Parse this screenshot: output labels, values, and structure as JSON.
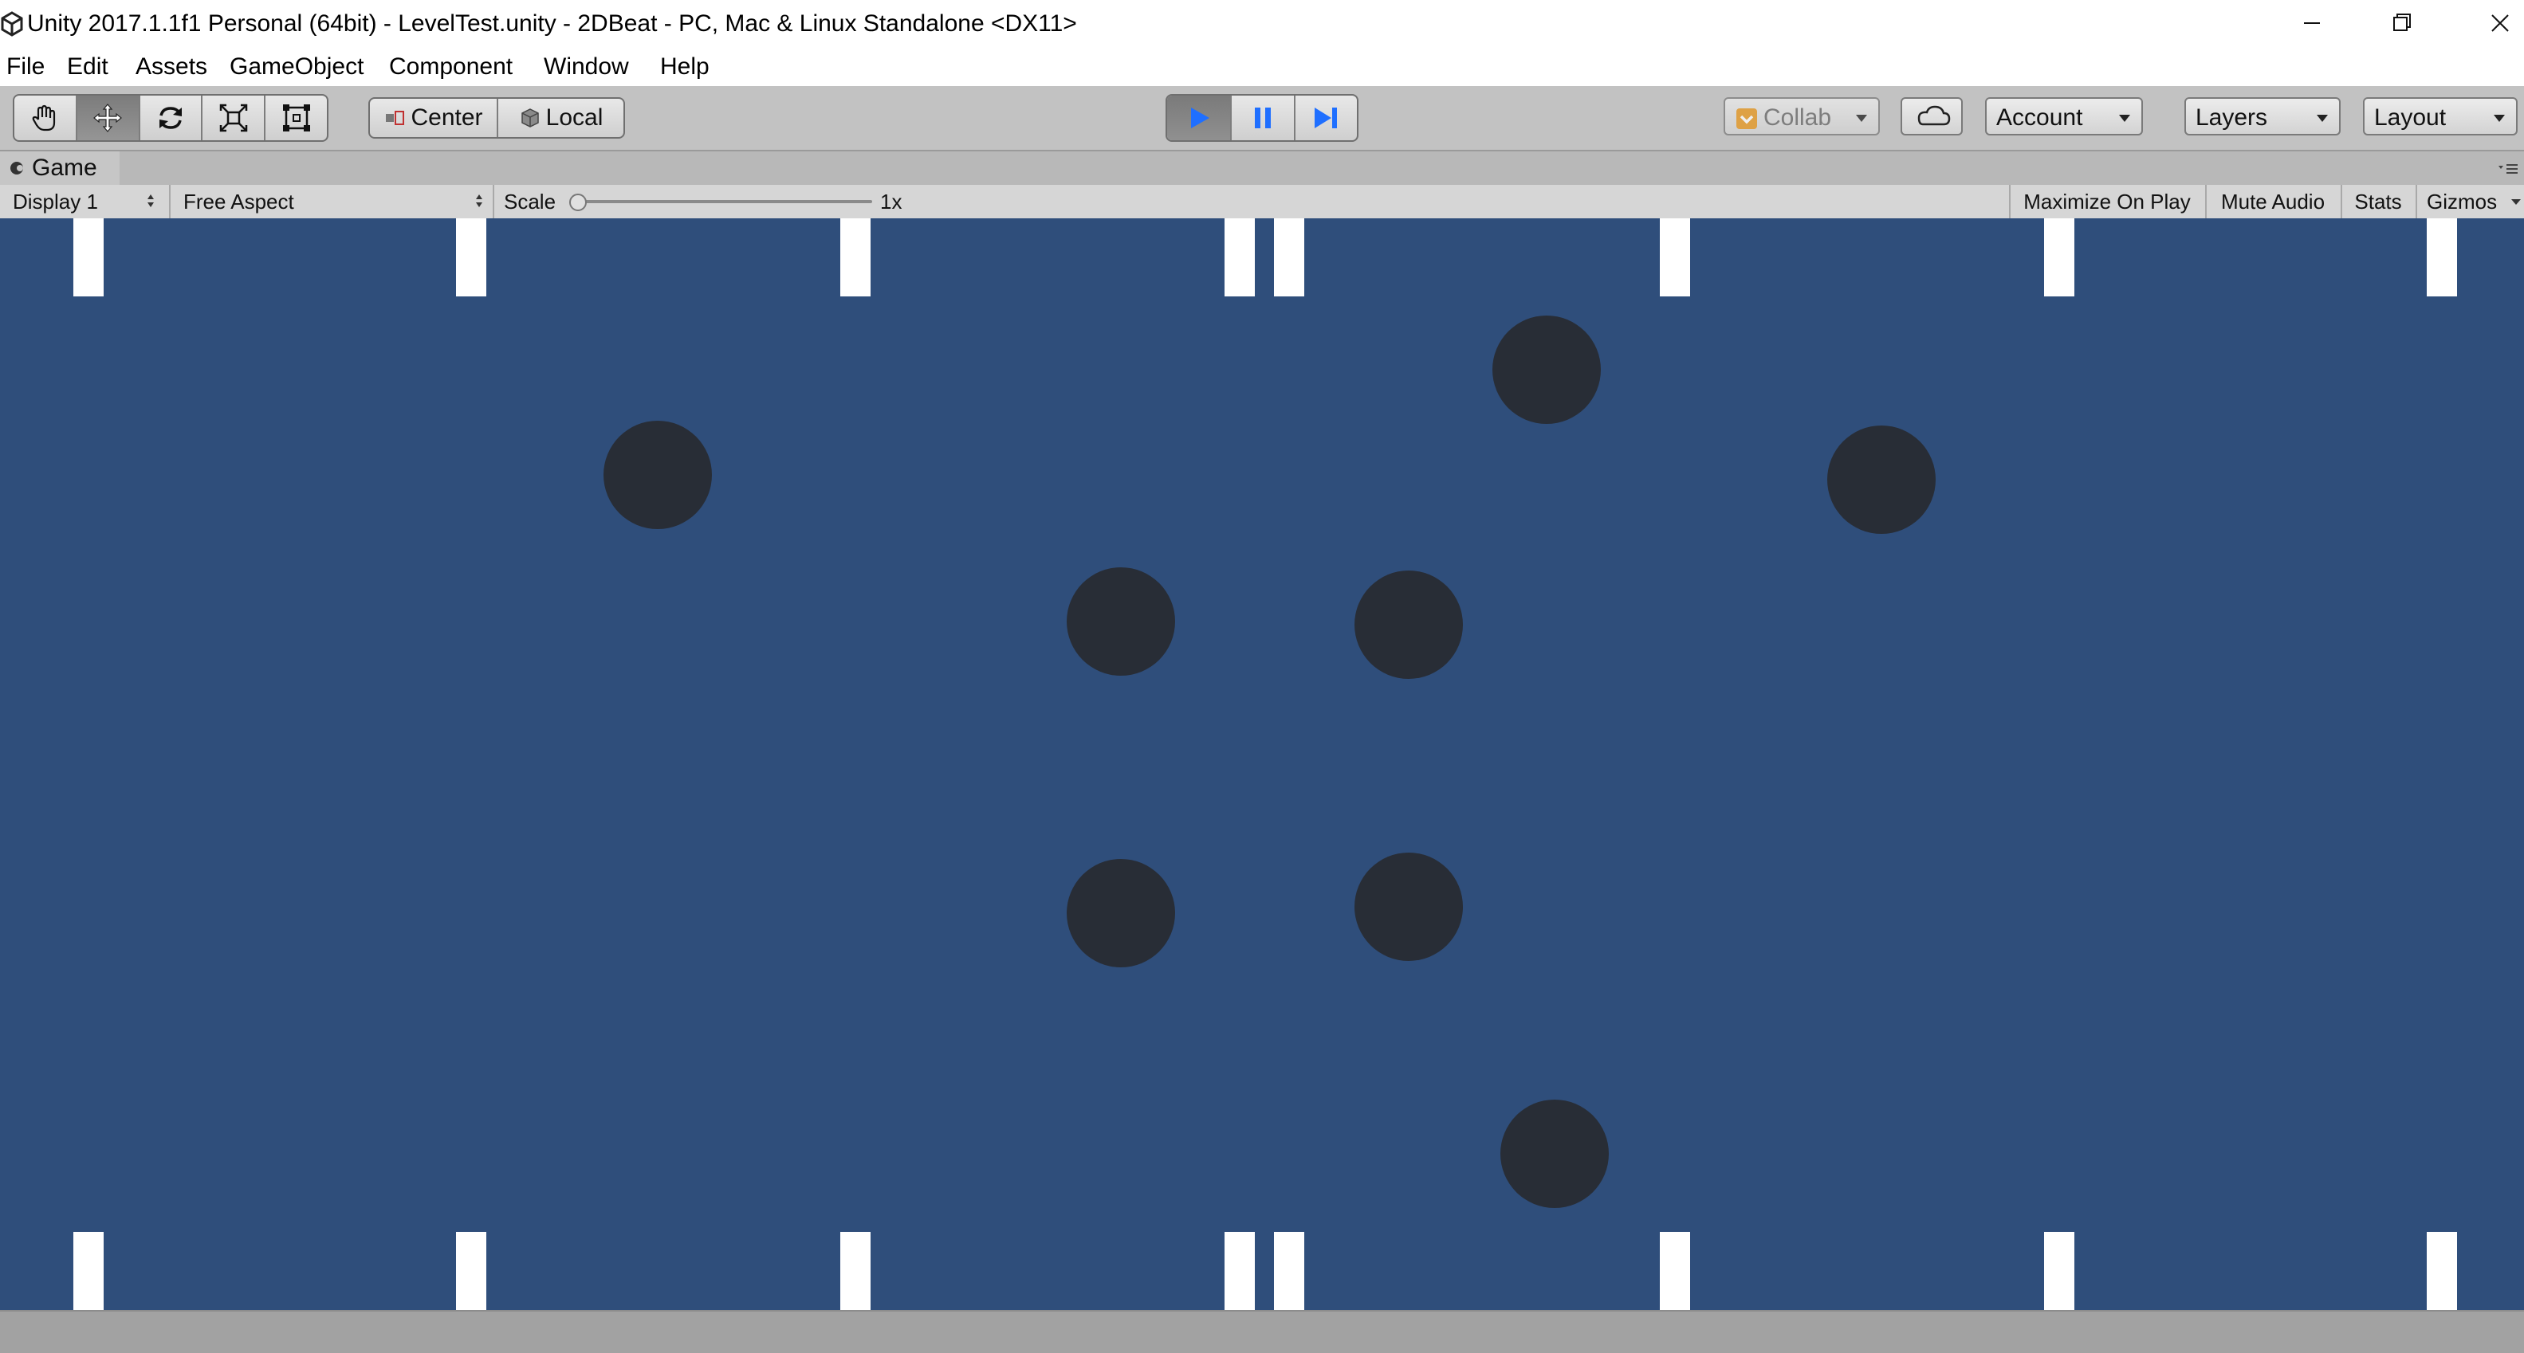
{
  "window": {
    "title": "Unity 2017.1.1f1 Personal (64bit) - LevelTest.unity - 2DBeat - PC, Mac & Linux Standalone <DX11>",
    "controls": {
      "minimize_icon": "minimize-icon",
      "maximize_icon": "restore-icon",
      "close_icon": "close-icon"
    }
  },
  "menu": {
    "items": [
      "File",
      "Edit",
      "Assets",
      "GameObject",
      "Component",
      "Window",
      "Help"
    ]
  },
  "toolbar": {
    "tools": [
      "hand-icon",
      "move-icon",
      "rotate-icon",
      "scale-icon",
      "rect-tool-icon"
    ],
    "active_tool": "move-icon",
    "pivot_label": "Center",
    "space_label": "Local",
    "play_state": "playing",
    "collab_label": "Collab",
    "account_label": "Account",
    "layers_label": "Layers",
    "layout_label": "Layout",
    "colors": {
      "play_active": "#1f6fff",
      "collab_icon": "#e8961c"
    }
  },
  "game_view": {
    "tab_label": "Game",
    "display_label": "Display 1",
    "aspect_label": "Free Aspect",
    "scale_label": "Scale",
    "scale_value": "1x",
    "maximize_label": "Maximize On Play",
    "mute_label": "Mute Audio",
    "stats_label": "Stats",
    "gizmos_label": "Gizmos",
    "colors": {
      "background": "#2f4e7b",
      "circle": "#282d36",
      "bar": "#ffffff"
    }
  }
}
